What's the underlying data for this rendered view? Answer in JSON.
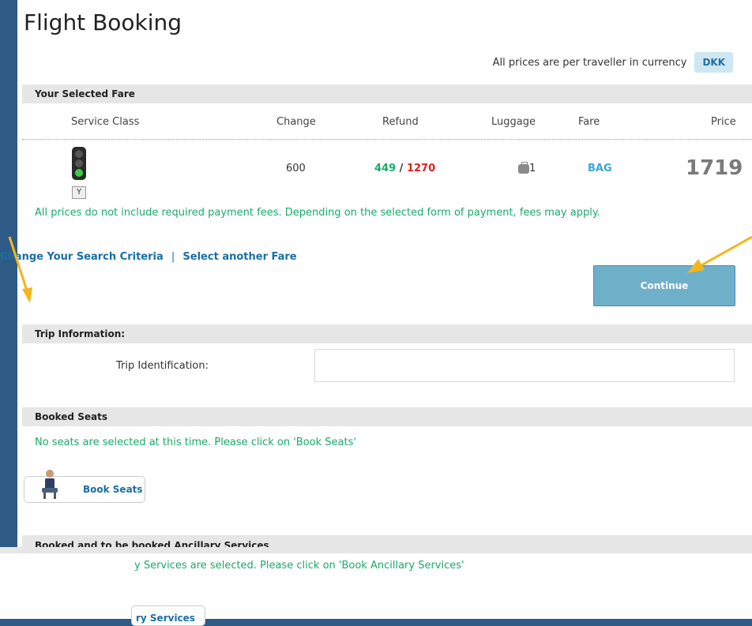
{
  "page": {
    "title": "Flight Booking",
    "currency_note": "All prices are per traveller in currency",
    "currency": "DKK"
  },
  "selected_fare": {
    "header": "Your Selected Fare",
    "columns": [
      "Service Class",
      "Change",
      "Refund",
      "Luggage",
      "Fare",
      "Price"
    ],
    "row": {
      "service_class_badge": "Y",
      "change": "600",
      "refund_low": "449",
      "refund_sep": "/",
      "refund_high": "1270",
      "luggage_count": "1",
      "fare": "BAG",
      "price": "1719"
    },
    "fees_note": "All prices do not include required payment fees. Depending on the selected form of payment, fees may apply."
  },
  "links": {
    "change_search": "Change Your Search Criteria",
    "separator": "|",
    "select_fare": "Select another Fare"
  },
  "continue_label": "Continue",
  "trip_info": {
    "header": "Trip Information:",
    "id_label": "Trip Identification:",
    "id_value": ""
  },
  "booked_seats": {
    "header": "Booked Seats",
    "note": "No seats are selected at this time. Please click on 'Book Seats'",
    "button_label": "Book Seats"
  },
  "ancillary": {
    "header": "Booked and to be booked Ancillary Services",
    "note_partial": "y Services are selected. Please click on 'Book Ancillary Services'",
    "button_partial": "ry Services"
  },
  "colors": {
    "refund_low": "#1aaa6a",
    "refund_high": "#e02020",
    "fare": "#3aa6d6",
    "price": "#7a7a7a",
    "annotation_arrow": "#f2b61c"
  },
  "icons": [
    "traffic-light-icon",
    "luggage-icon",
    "seat-passenger-icon"
  ]
}
